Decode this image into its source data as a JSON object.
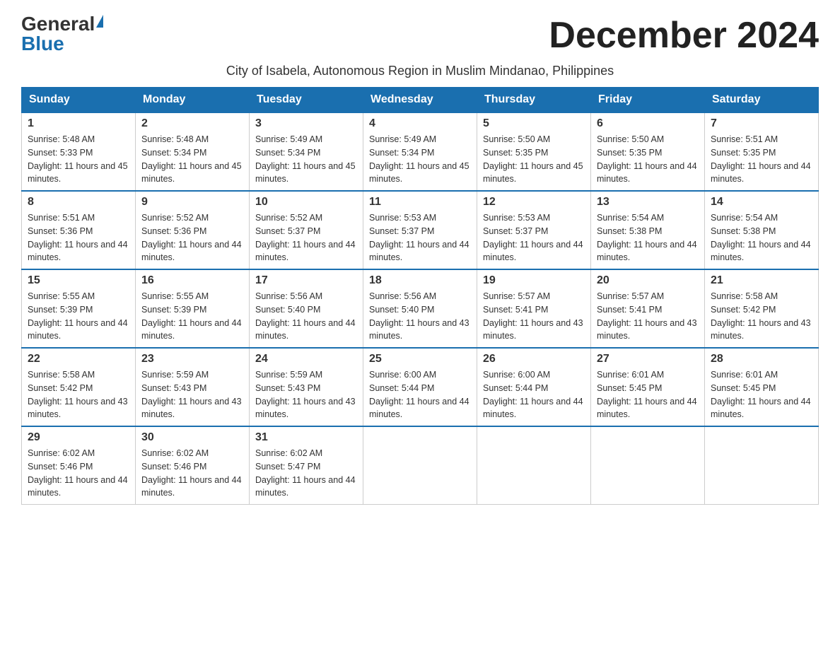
{
  "header": {
    "logo_general": "General",
    "logo_blue": "Blue",
    "month_title": "December 2024",
    "subtitle": "City of Isabela, Autonomous Region in Muslim Mindanao, Philippines"
  },
  "weekdays": [
    "Sunday",
    "Monday",
    "Tuesday",
    "Wednesday",
    "Thursday",
    "Friday",
    "Saturday"
  ],
  "weeks": [
    [
      {
        "day": "1",
        "sunrise": "5:48 AM",
        "sunset": "5:33 PM",
        "daylight": "11 hours and 45 minutes."
      },
      {
        "day": "2",
        "sunrise": "5:48 AM",
        "sunset": "5:34 PM",
        "daylight": "11 hours and 45 minutes."
      },
      {
        "day": "3",
        "sunrise": "5:49 AM",
        "sunset": "5:34 PM",
        "daylight": "11 hours and 45 minutes."
      },
      {
        "day": "4",
        "sunrise": "5:49 AM",
        "sunset": "5:34 PM",
        "daylight": "11 hours and 45 minutes."
      },
      {
        "day": "5",
        "sunrise": "5:50 AM",
        "sunset": "5:35 PM",
        "daylight": "11 hours and 45 minutes."
      },
      {
        "day": "6",
        "sunrise": "5:50 AM",
        "sunset": "5:35 PM",
        "daylight": "11 hours and 44 minutes."
      },
      {
        "day": "7",
        "sunrise": "5:51 AM",
        "sunset": "5:35 PM",
        "daylight": "11 hours and 44 minutes."
      }
    ],
    [
      {
        "day": "8",
        "sunrise": "5:51 AM",
        "sunset": "5:36 PM",
        "daylight": "11 hours and 44 minutes."
      },
      {
        "day": "9",
        "sunrise": "5:52 AM",
        "sunset": "5:36 PM",
        "daylight": "11 hours and 44 minutes."
      },
      {
        "day": "10",
        "sunrise": "5:52 AM",
        "sunset": "5:37 PM",
        "daylight": "11 hours and 44 minutes."
      },
      {
        "day": "11",
        "sunrise": "5:53 AM",
        "sunset": "5:37 PM",
        "daylight": "11 hours and 44 minutes."
      },
      {
        "day": "12",
        "sunrise": "5:53 AM",
        "sunset": "5:37 PM",
        "daylight": "11 hours and 44 minutes."
      },
      {
        "day": "13",
        "sunrise": "5:54 AM",
        "sunset": "5:38 PM",
        "daylight": "11 hours and 44 minutes."
      },
      {
        "day": "14",
        "sunrise": "5:54 AM",
        "sunset": "5:38 PM",
        "daylight": "11 hours and 44 minutes."
      }
    ],
    [
      {
        "day": "15",
        "sunrise": "5:55 AM",
        "sunset": "5:39 PM",
        "daylight": "11 hours and 44 minutes."
      },
      {
        "day": "16",
        "sunrise": "5:55 AM",
        "sunset": "5:39 PM",
        "daylight": "11 hours and 44 minutes."
      },
      {
        "day": "17",
        "sunrise": "5:56 AM",
        "sunset": "5:40 PM",
        "daylight": "11 hours and 44 minutes."
      },
      {
        "day": "18",
        "sunrise": "5:56 AM",
        "sunset": "5:40 PM",
        "daylight": "11 hours and 43 minutes."
      },
      {
        "day": "19",
        "sunrise": "5:57 AM",
        "sunset": "5:41 PM",
        "daylight": "11 hours and 43 minutes."
      },
      {
        "day": "20",
        "sunrise": "5:57 AM",
        "sunset": "5:41 PM",
        "daylight": "11 hours and 43 minutes."
      },
      {
        "day": "21",
        "sunrise": "5:58 AM",
        "sunset": "5:42 PM",
        "daylight": "11 hours and 43 minutes."
      }
    ],
    [
      {
        "day": "22",
        "sunrise": "5:58 AM",
        "sunset": "5:42 PM",
        "daylight": "11 hours and 43 minutes."
      },
      {
        "day": "23",
        "sunrise": "5:59 AM",
        "sunset": "5:43 PM",
        "daylight": "11 hours and 43 minutes."
      },
      {
        "day": "24",
        "sunrise": "5:59 AM",
        "sunset": "5:43 PM",
        "daylight": "11 hours and 43 minutes."
      },
      {
        "day": "25",
        "sunrise": "6:00 AM",
        "sunset": "5:44 PM",
        "daylight": "11 hours and 44 minutes."
      },
      {
        "day": "26",
        "sunrise": "6:00 AM",
        "sunset": "5:44 PM",
        "daylight": "11 hours and 44 minutes."
      },
      {
        "day": "27",
        "sunrise": "6:01 AM",
        "sunset": "5:45 PM",
        "daylight": "11 hours and 44 minutes."
      },
      {
        "day": "28",
        "sunrise": "6:01 AM",
        "sunset": "5:45 PM",
        "daylight": "11 hours and 44 minutes."
      }
    ],
    [
      {
        "day": "29",
        "sunrise": "6:02 AM",
        "sunset": "5:46 PM",
        "daylight": "11 hours and 44 minutes."
      },
      {
        "day": "30",
        "sunrise": "6:02 AM",
        "sunset": "5:46 PM",
        "daylight": "11 hours and 44 minutes."
      },
      {
        "day": "31",
        "sunrise": "6:02 AM",
        "sunset": "5:47 PM",
        "daylight": "11 hours and 44 minutes."
      },
      null,
      null,
      null,
      null
    ]
  ]
}
